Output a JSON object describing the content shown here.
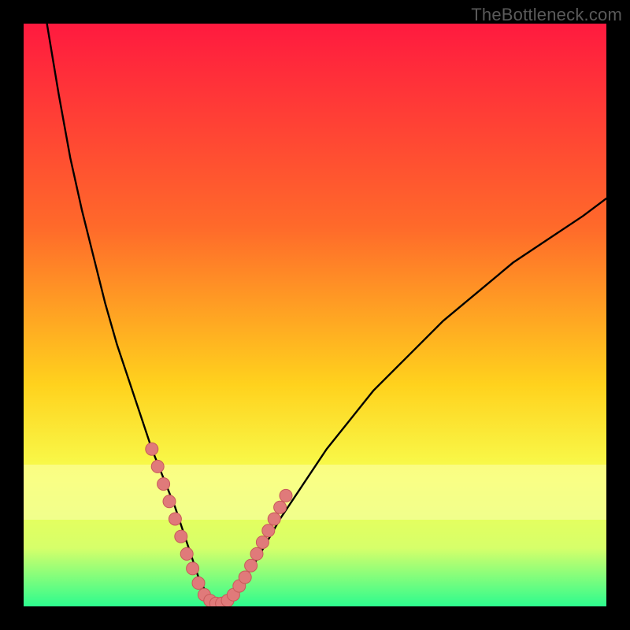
{
  "watermark": {
    "text": "TheBottleneck.com"
  },
  "colors": {
    "bg_black": "#000000",
    "grad_top": "#ff1a3f",
    "grad_mid1": "#ff6a2a",
    "grad_mid2": "#ffd21d",
    "grad_mid3": "#f7ff50",
    "grad_mid4": "#d6ff6a",
    "grad_bottom": "#2dfc8e",
    "pale_band": "#fbffb0",
    "curve": "#000000",
    "dot_fill": "#e07a7a",
    "dot_stroke": "#c85a5a"
  },
  "chart_data": {
    "type": "line",
    "title": "",
    "xlabel": "",
    "ylabel": "",
    "xlim": [
      0,
      100
    ],
    "ylim": [
      0,
      100
    ],
    "series": [
      {
        "name": "bottleneck-curve",
        "x": [
          4,
          6,
          8,
          10,
          12,
          14,
          16,
          18,
          20,
          22,
          24,
          26,
          27,
          28,
          29,
          30,
          31,
          32,
          33,
          34,
          35,
          36,
          38,
          40,
          44,
          48,
          52,
          56,
          60,
          66,
          72,
          78,
          84,
          90,
          96,
          100
        ],
        "y": [
          100,
          88,
          77,
          68,
          60,
          52,
          45,
          39,
          33,
          27,
          22,
          17,
          14,
          11,
          8,
          5,
          3,
          1.5,
          0.5,
          0.5,
          1,
          2,
          5,
          8,
          15,
          21,
          27,
          32,
          37,
          43,
          49,
          54,
          59,
          63,
          67,
          70
        ]
      }
    ],
    "highlight_points": {
      "name": "coral-dots",
      "x": [
        22,
        23,
        24,
        25,
        26,
        27,
        28,
        29,
        30,
        31,
        32,
        33,
        34,
        35,
        36,
        37,
        38,
        39,
        40,
        41,
        42,
        43,
        44,
        45
      ],
      "y": [
        27,
        24,
        21,
        18,
        15,
        12,
        9,
        6.5,
        4,
        2,
        1,
        0.5,
        0.5,
        1,
        2,
        3.5,
        5,
        7,
        9,
        11,
        13,
        15,
        17,
        19
      ]
    }
  }
}
